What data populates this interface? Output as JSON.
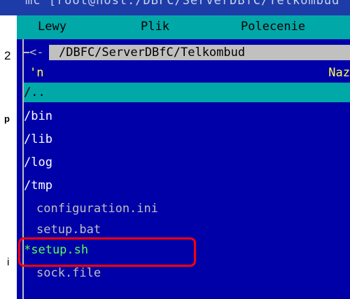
{
  "window": {
    "title_fragment": "mc [root@host:/DBFC/ServerDBfC/Telkombud"
  },
  "background_fragments": [
    "2",
    "p",
    "i"
  ],
  "menubar": {
    "items": [
      "Lewy",
      "Plik",
      "Polecenie"
    ]
  },
  "panel": {
    "path_arrow": "<-",
    "path": "/DBFC/ServerDBfC/Telkombud",
    "column_headers": {
      "left": "'n",
      "right": "Naz"
    },
    "entries": [
      {
        "name": "/..",
        "type": "dir",
        "selected": true
      },
      {
        "name": "/bin",
        "type": "dir"
      },
      {
        "name": "/lib",
        "type": "dir"
      },
      {
        "name": "/log",
        "type": "dir"
      },
      {
        "name": "/tmp",
        "type": "dir"
      },
      {
        "name": "configuration.ini",
        "type": "file"
      },
      {
        "name": "setup.bat",
        "type": "file"
      },
      {
        "name": "*setup.sh",
        "type": "executable"
      },
      {
        "name": "sock.file",
        "type": "file"
      }
    ]
  },
  "annotation": {
    "highlighted_entry": "*setup.sh",
    "color": "#ff0000"
  },
  "colors": {
    "panel_background": "#0000a8",
    "menubar_background": "#00a8a8",
    "selection_background": "#00a8a8",
    "header_text": "#ffff55",
    "executable_text": "#55ff55",
    "path_background": "#c0c0c0"
  }
}
